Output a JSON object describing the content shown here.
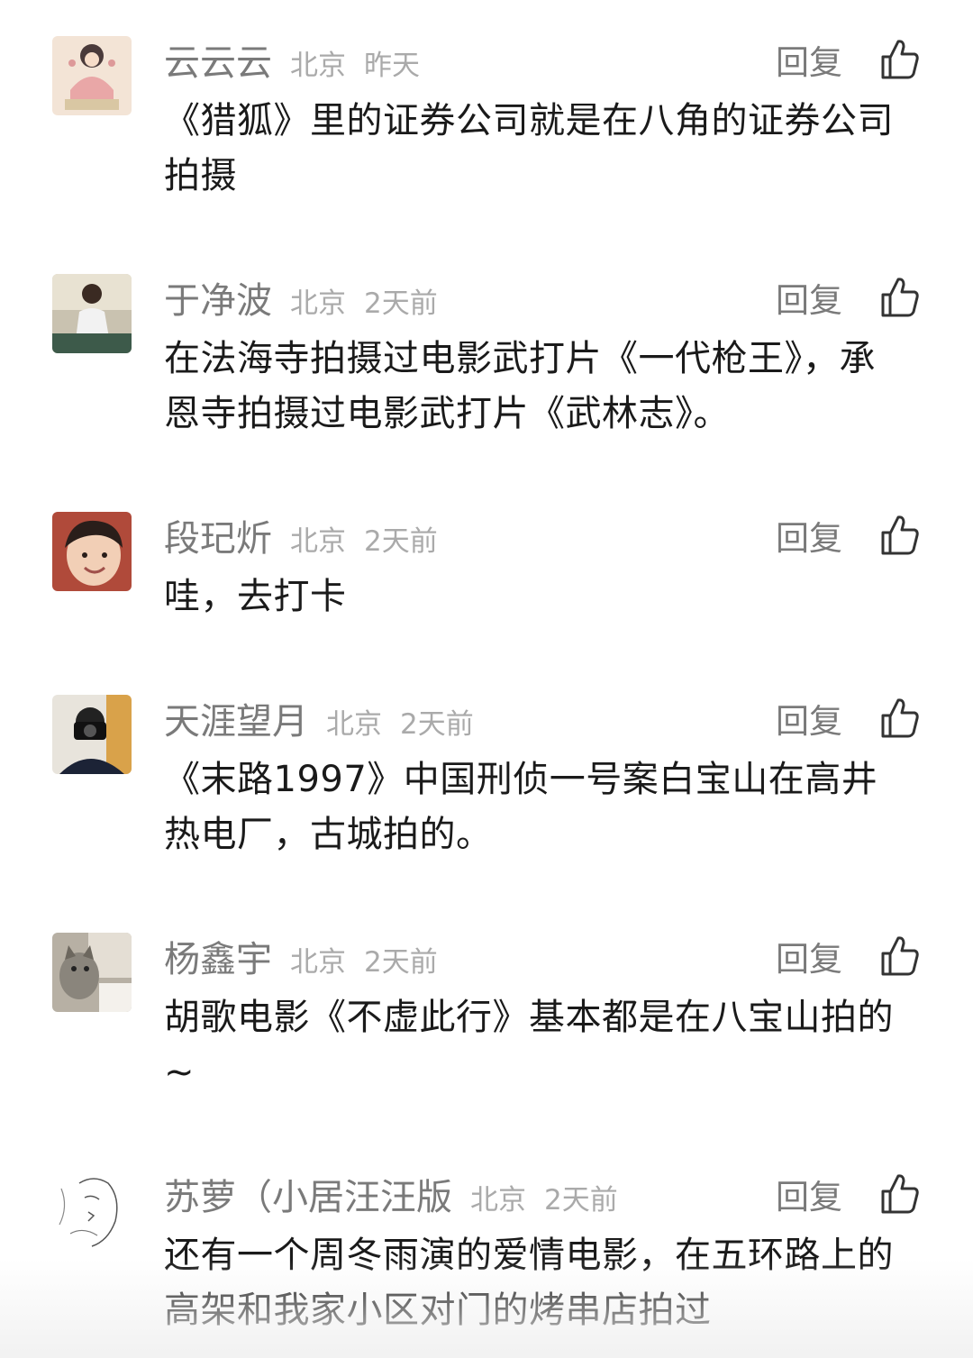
{
  "reply_label": "回复",
  "comments": [
    {
      "username": "云云云",
      "location": "北京",
      "time": "昨天",
      "lines": [
        "《猎狐》里的证券公司就是在八角的证券公司",
        "拍摄"
      ]
    },
    {
      "username": "于净波",
      "location": "北京",
      "time": "2天前",
      "lines": [
        "在法海寺拍摄过电影武打片《一代枪王》，承",
        "恩寺拍摄过电影武打片《武林志》。"
      ]
    },
    {
      "username": "段玘炘",
      "location": "北京",
      "time": "2天前",
      "lines": [
        "哇，去打卡"
      ]
    },
    {
      "username": "天涯望月",
      "location": "北京",
      "time": "2天前",
      "lines": [
        "《末路1997》中国刑侦一号案白宝山在高井",
        "热电厂，古城拍的。"
      ]
    },
    {
      "username": "杨鑫宇",
      "location": "北京",
      "time": "2天前",
      "lines": [
        "胡歌电影《不虚此行》基本都是在八宝山拍的",
        "~"
      ]
    },
    {
      "username": "苏萝（小居汪汪版",
      "location": "北京",
      "time": "2天前",
      "lines": [
        "还有一个周冬雨演的爱情电影，在五环路上的",
        "高架和我家小区对门的烤串店拍过"
      ]
    }
  ],
  "icons": {
    "like": "thumbs-up-icon"
  },
  "colors": {
    "username": "#7a7a7a",
    "meta": "#aaaaaa",
    "text": "#1a1a1a"
  }
}
